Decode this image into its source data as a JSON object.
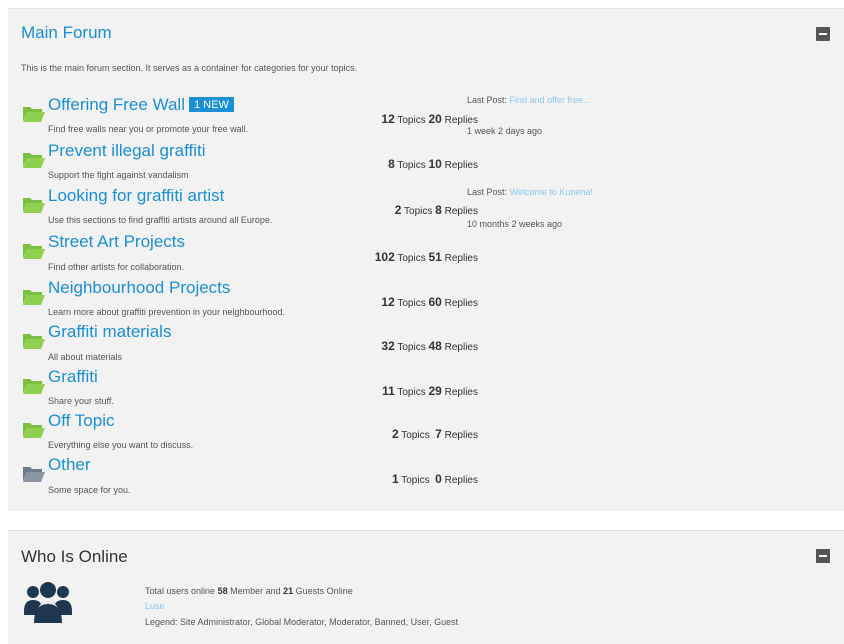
{
  "forum": {
    "title": "Main Forum",
    "description": "This is the main forum section. It serves as a container for categories for your topics.",
    "categories": [
      {
        "title": "Offering Free Wall",
        "badge": "1 NEW",
        "desc": "Find free walls near you or promote your free wall.",
        "topics": "12",
        "topics_label": "Topics",
        "replies": "20",
        "replies_label": "Replies",
        "last_post_label": "Last Post:",
        "last_post_link": "Find and offer free...",
        "last_time": "1 week 2 days ago"
      },
      {
        "title": "Prevent illegal graffiti",
        "desc": "Support the fight against vandalism",
        "topics": "8",
        "topics_label": "Topics",
        "replies": "10",
        "replies_label": "Replies"
      },
      {
        "title": "Looking for graffiti artist",
        "desc": "Use this sections to find graffiti artists around all Europe.",
        "topics": "2",
        "topics_label": "Topics",
        "replies": "8",
        "replies_label": "Replies",
        "last_post_label": "Last Post:",
        "last_post_link": "Welcome to Kunena!",
        "last_time": "10 months 2 weeks ago"
      },
      {
        "title": "Street Art Projects",
        "desc": "Find other artists for collaboration.",
        "topics": "102",
        "topics_label": "Topics",
        "replies": "51",
        "replies_label": "Replies"
      },
      {
        "title": "Neighbourhood Projects",
        "desc": "Learn more about graffiti prevention in your neighbourhood.",
        "topics": "12",
        "topics_label": "Topics",
        "replies": "60",
        "replies_label": "Replies"
      },
      {
        "title": "Graffiti materials",
        "desc": "All about materials",
        "topics": "32",
        "topics_label": "Topics",
        "replies": "48",
        "replies_label": "Replies"
      },
      {
        "title": "Graffiti",
        "desc": "Share your stuff.",
        "topics": "11",
        "topics_label": "Topics",
        "replies": "29",
        "replies_label": "Replies"
      },
      {
        "title": "Off Topic",
        "desc": "Everything else you want to discuss.",
        "topics": "2",
        "topics_label": "Topics",
        "replies": "7",
        "replies_label": "Replies"
      },
      {
        "title": "Other",
        "desc": "Some space for you.",
        "topics": "1",
        "topics_label": "Topics",
        "replies": "0",
        "replies_label": "Replies"
      }
    ]
  },
  "online": {
    "title": "Who Is Online",
    "total_prefix": "Total users online",
    "members": "58",
    "members_label": "Member and",
    "guests": "21",
    "guests_label": "Guests Online",
    "user": "Luse",
    "legend": "Legend:  Site Administrator,  Global Moderator,  Moderator,  Banned,  User,  Guest"
  },
  "icons": {
    "folder": "folder-open-icon",
    "folder_other": "folder-icon",
    "users": "users-group-icon",
    "collapse": "collapse-icon"
  },
  "colors": {
    "link": "#1a8fd6",
    "folder_green": "#7cc043",
    "folder_gray": "#7f8c99",
    "users_icon": "#1f3550",
    "panel_bg": "#f2f2f2"
  }
}
